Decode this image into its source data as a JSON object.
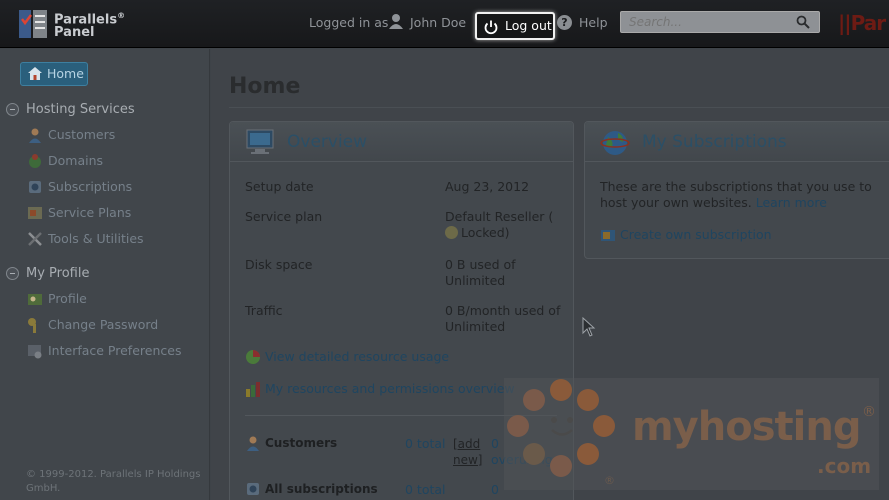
{
  "header": {
    "logo_line1": "Parallels",
    "logo_reg": "®",
    "logo_line2": "Panel",
    "logged_in_as": "Logged in as",
    "user_name": "John Doe",
    "logout_label": "Log out",
    "help_label": "Help",
    "search_placeholder": "Search...",
    "brand_right": "||Par"
  },
  "sidebar": {
    "home_label": "Home",
    "sections": [
      {
        "title": "Hosting Services",
        "items": [
          {
            "label": "Customers",
            "icon": "customers-icon"
          },
          {
            "label": "Domains",
            "icon": "domains-icon"
          },
          {
            "label": "Subscriptions",
            "icon": "subscriptions-icon"
          },
          {
            "label": "Service Plans",
            "icon": "service-plans-icon"
          },
          {
            "label": "Tools & Utilities",
            "icon": "tools-icon"
          }
        ]
      },
      {
        "title": "My Profile",
        "items": [
          {
            "label": "Profile",
            "icon": "profile-icon"
          },
          {
            "label": "Change Password",
            "icon": "key-icon"
          },
          {
            "label": "Interface Preferences",
            "icon": "preferences-icon"
          }
        ]
      }
    ],
    "copyright": "© 1999-2012. Parallels IP Holdings GmbH."
  },
  "main": {
    "page_title": "Home",
    "overview": {
      "title": "Overview",
      "rows": [
        {
          "label": "Setup date",
          "value": "Aug 23, 2012"
        },
        {
          "label": "Service plan",
          "value": "Default Reseller (",
          "value2": "Locked)"
        },
        {
          "label": "Disk space",
          "value": "0 B used of Unlimited"
        },
        {
          "label": "Traffic",
          "value": "0 B/month used of Unlimited"
        }
      ],
      "link_usage": "View detailed resource usage",
      "link_permissions": "My resources and permissions overview",
      "stats": [
        {
          "label": "Customers",
          "total": "0 total",
          "add": "[add",
          "new": "new]",
          "count": "0",
          "extra": "overusing"
        },
        {
          "label": "All subscriptions",
          "total": "0 total",
          "count": "0"
        }
      ]
    },
    "subscriptions": {
      "title": "My Subscriptions",
      "text": "These are the subscriptions that you use to host your own websites.",
      "learn_more": "Learn more",
      "create_link": "Create own subscription"
    }
  },
  "watermark": {
    "text": "myhosting",
    "com": ".com",
    "reg": "®"
  },
  "colors": {
    "accent": "#2a5f7c",
    "link": "#1f4560",
    "watermark": "#7a5e4a"
  }
}
